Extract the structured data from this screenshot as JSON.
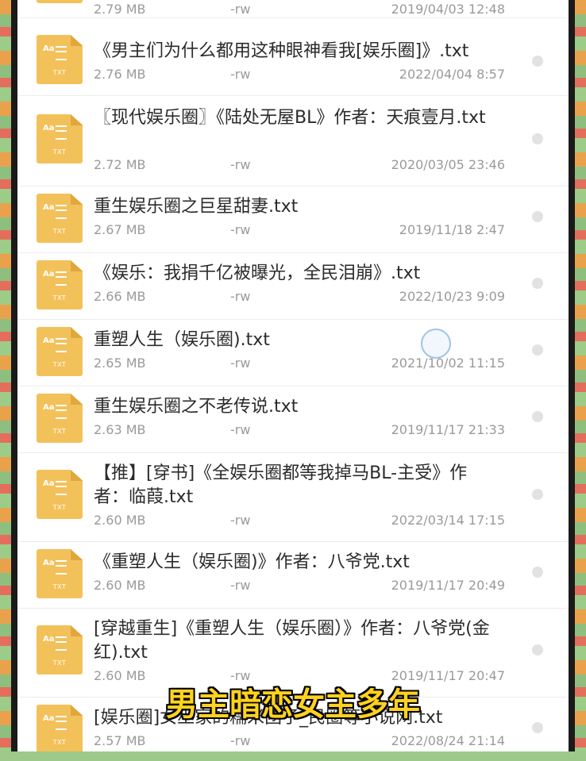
{
  "files": [
    {
      "name": "",
      "size": "2.79 MB",
      "perm": "-rw",
      "date": "2019/04/03 12:48"
    },
    {
      "name": "《男主们为什么都用这种眼神看我[娱乐圈]》.txt",
      "size": "2.76 MB",
      "perm": "-rw",
      "date": "2022/04/04 8:57"
    },
    {
      "name": "〖现代娱乐圈〗《陆处无屋BL》作者：天痕壹月.txt",
      "size": "2.72 MB",
      "perm": "-rw",
      "date": "2020/03/05 23:46"
    },
    {
      "name": "重生娱乐圈之巨星甜妻.txt",
      "size": "2.67 MB",
      "perm": "-rw",
      "date": "2019/11/18 2:47"
    },
    {
      "name": "《娱乐：我捐千亿被曝光，全民泪崩》.txt",
      "size": "2.66 MB",
      "perm": "-rw",
      "date": "2022/10/23 9:09"
    },
    {
      "name": "重塑人生（娱乐圈).txt",
      "size": "2.65 MB",
      "perm": "-rw",
      "date": "2021/10/02 11:15"
    },
    {
      "name": "重生娱乐圈之不老传说.txt",
      "size": "2.63 MB",
      "perm": "-rw",
      "date": "2019/11/17 21:33"
    },
    {
      "name": "【推】[穿书]《全娱乐圈都等我掉马BL-主受》作者：临葭.txt",
      "size": "2.60 MB",
      "perm": "-rw",
      "date": "2022/03/14 17:15"
    },
    {
      "name": "《重塑人生（娱乐圈)》作者：八爷党.txt",
      "size": "2.60 MB",
      "perm": "-rw",
      "date": "2019/11/17 20:49"
    },
    {
      "name": "[穿越重生]《重塑人生（娱乐圈）》作者：八爷党(金 红).txt",
      "size": "2.60 MB",
      "perm": "-rw",
      "date": "2019/11/17 20:47"
    },
    {
      "name": "[娱乐圈]女巫家的糯米团子_民圈等小说网.txt",
      "size": "2.57 MB",
      "perm": "-rw",
      "date": "2022/08/24 21:14"
    }
  ],
  "icon": {
    "aa": "Aa",
    "txt": "TXT"
  },
  "caption": "男主暗恋女主多年",
  "colors": {
    "caption": "#ffd21f",
    "icon": "#f3c15a"
  }
}
